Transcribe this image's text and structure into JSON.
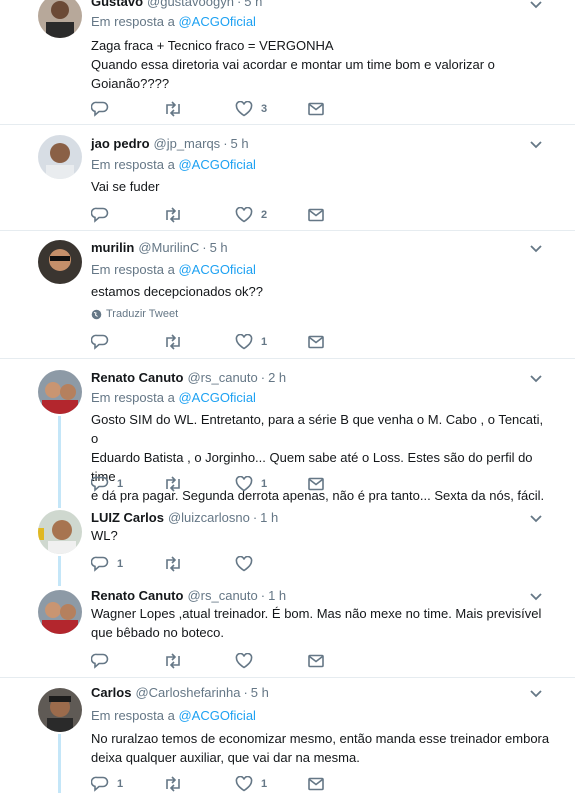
{
  "tweets": [
    {
      "name": "Gustavo",
      "handle": "@gustavoogyn",
      "time": "5 h",
      "reply_prefix": "Em resposta a",
      "reply_to": "@ACGOficial",
      "text_lines": [
        "Zaga fraca + Tecnico fraco = VERGONHA",
        "Quando essa diretoria vai acordar e montar um time bom e valorizar o",
        "Goianão????"
      ],
      "replies": "",
      "retweets": "",
      "likes": "3"
    },
    {
      "name": "jao pedro",
      "handle": "@jp_marqs",
      "time": "5 h",
      "reply_prefix": "Em resposta a",
      "reply_to": "@ACGOficial",
      "text_lines": [
        "Vai se fuder"
      ],
      "replies": "",
      "retweets": "",
      "likes": "2"
    },
    {
      "name": "murilin",
      "handle": "@MurilinC",
      "time": "5 h",
      "reply_prefix": "Em resposta a",
      "reply_to": "@ACGOficial",
      "text_lines": [
        "estamos decepcionados ok??"
      ],
      "translate": "Traduzir Tweet",
      "replies": "",
      "retweets": "",
      "likes": "1"
    },
    {
      "name": "Renato Canuto",
      "handle": "@rs_canuto",
      "time": "2 h",
      "reply_prefix": "Em resposta a",
      "reply_to": "@ACGOficial",
      "text_lines": [
        "Gosto SIM do WL. Entretanto, para a série B que venha o M. Cabo , o Tencati, o",
        "Eduardo Batista , o Jorginho... Quem sabe até o Loss. Estes são do perfil do time",
        "e dá pra pagar. Segunda derrota apenas, não é pra tanto... Sexta da nós, fácil."
      ],
      "replies": "1",
      "retweets": "",
      "likes": "1"
    },
    {
      "name": "LUIZ Carlos",
      "handle": "@luizcarlosno",
      "time": "1 h",
      "text_lines": [
        "WL?"
      ],
      "replies": "1",
      "retweets": "",
      "likes": ""
    },
    {
      "name": "Renato Canuto",
      "handle": "@rs_canuto",
      "time": "1 h",
      "text_lines": [
        "Wagner Lopes ,atual treinador. É bom. Mas não mexe no time. Mais previsível",
        "que bêbado no boteco."
      ],
      "replies": "",
      "retweets": "",
      "likes": ""
    },
    {
      "name": "Carlos",
      "handle": "@Carloshefarinha",
      "time": "5 h",
      "reply_prefix": "Em resposta a",
      "reply_to": "@ACGOficial",
      "text_lines": [
        "No ruralzao temos de economizar mesmo, então manda esse treinador embora",
        "deixa qualquer auxiliar, que vai dar na mesma."
      ],
      "replies": "1",
      "retweets": "",
      "likes": "1"
    }
  ],
  "colors": {
    "link": "#1da1f2",
    "muted": "#657786",
    "text": "#14171a",
    "thread": "#c4e6f8"
  },
  "icons": [
    "reply-icon",
    "retweet-icon",
    "like-icon",
    "message-icon",
    "chevron-down-icon",
    "globe-icon"
  ]
}
